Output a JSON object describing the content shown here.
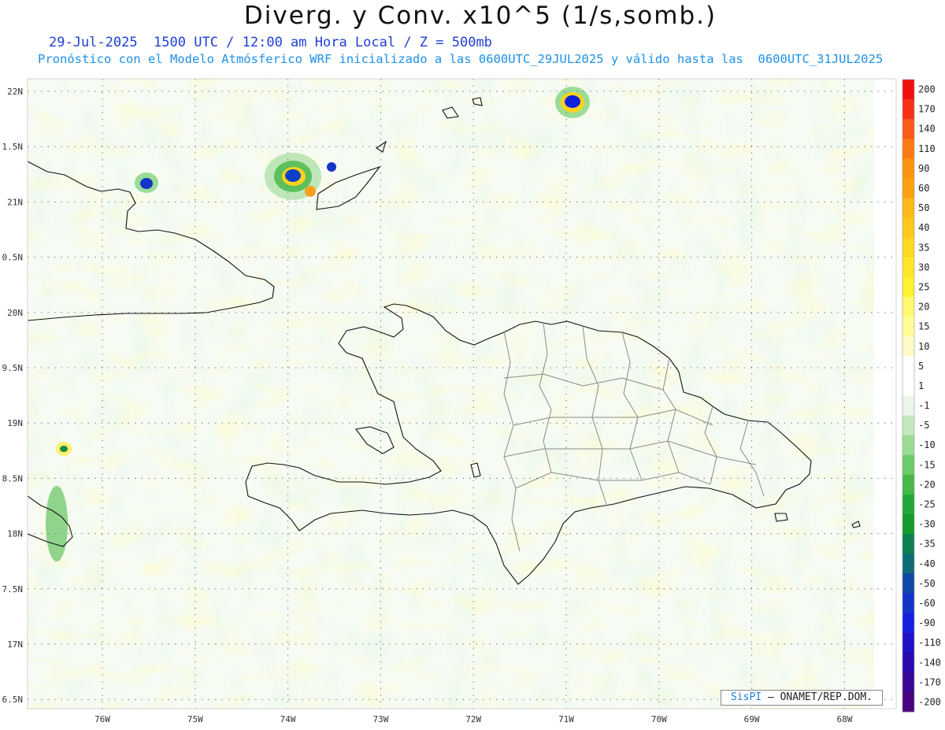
{
  "header": {
    "title": "Diverg. y Conv. x10^5 (1/s,somb.)",
    "valid_line": "29-Jul-2025  1500 UTC / 12:00 am Hora Local / Z = 500mb",
    "forecast_line": "Pronóstico con el Modelo Atmósferico WRF inicializado a las 0600UTC_29JUL2025 y válido hasta las  0600UTC_31JUL2025"
  },
  "map": {
    "lat_labels": [
      "22N",
      "1.5N",
      "21N",
      "0.5N",
      "20N",
      "9.5N",
      "19N",
      "8.5N",
      "18N",
      "7.5N",
      "17N",
      "6.5N"
    ],
    "lon_labels": [
      "76W",
      "75W",
      "74W",
      "73W",
      "72W",
      "71W",
      "70W",
      "69W",
      "68W"
    ],
    "lat_range": [
      16.5,
      22.1
    ],
    "lon_range": [
      -76.6,
      -67.7
    ],
    "grid": true
  },
  "colorbar": {
    "labels": [
      "200",
      "170",
      "140",
      "110",
      "90",
      "60",
      "50",
      "40",
      "35",
      "30",
      "25",
      "20",
      "15",
      "10",
      "5",
      "1",
      "-1",
      "-5",
      "-10",
      "-15",
      "-20",
      "-25",
      "-30",
      "-35",
      "-40",
      "-50",
      "-60",
      "-90",
      "-110",
      "-140",
      "-170",
      "-200"
    ],
    "colors": [
      "#f01010",
      "#f83018",
      "#fb5a18",
      "#fc7a14",
      "#fd9410",
      "#fea010",
      "#ffb818",
      "#ffc81c",
      "#ffd820",
      "#ffe628",
      "#fff030",
      "#fff870",
      "#fffc9a",
      "#fffac8",
      "#ffffff",
      "#ffffff",
      "#eaf6ea",
      "#c2e8c0",
      "#9adc96",
      "#6ccb6a",
      "#46b848",
      "#22a83a",
      "#119c2c",
      "#0c8050",
      "#0e6c78",
      "#1048a8",
      "#1434c8",
      "#1420e0",
      "#2010c8",
      "#2a0ab0",
      "#3a0898",
      "#4a0480"
    ]
  },
  "credit": {
    "brand": "SisPI",
    "rest": "– ONAMET/REP.DOM."
  }
}
